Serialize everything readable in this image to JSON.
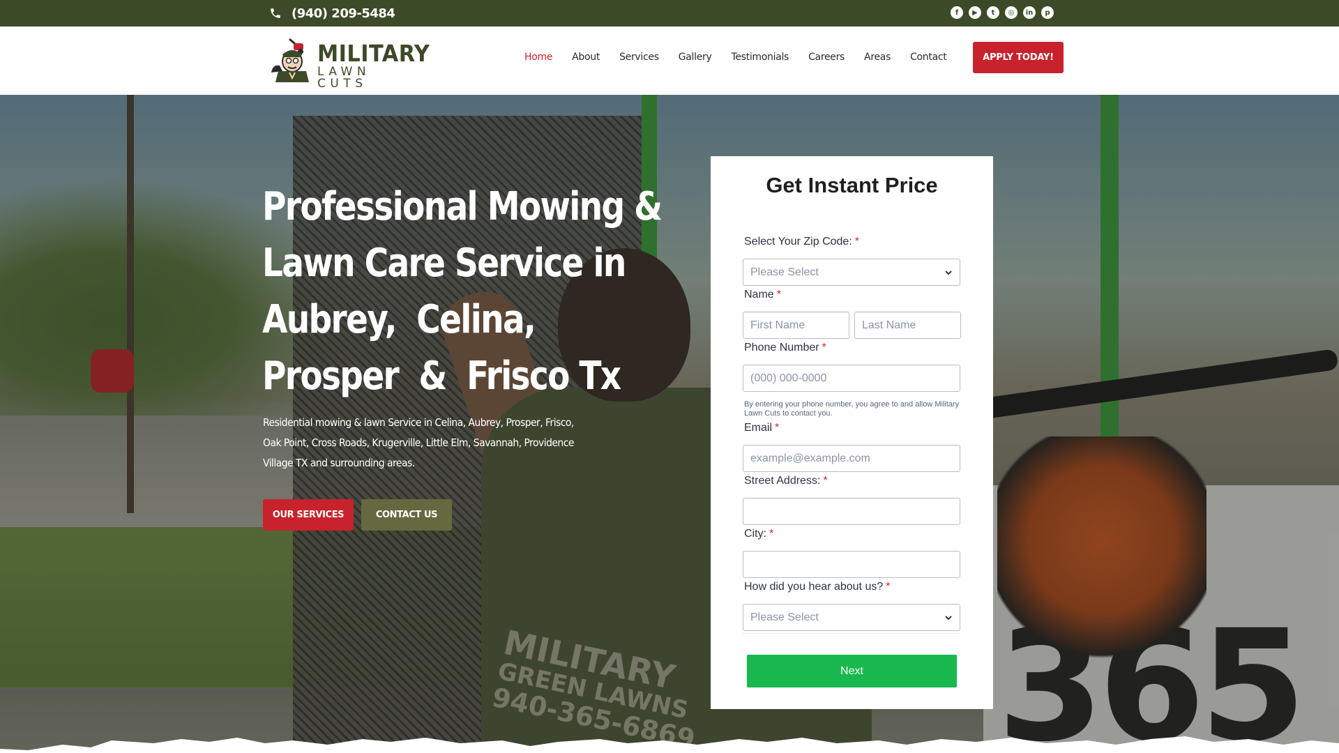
{
  "topbar": {
    "phone": "(940) 209-5484",
    "socials": [
      {
        "icon": "facebook-icon",
        "glyph": "f"
      },
      {
        "icon": "youtube-icon",
        "glyph": "▶"
      },
      {
        "icon": "twitter-icon",
        "glyph": "t"
      },
      {
        "icon": "instagram-icon",
        "glyph": "◎"
      },
      {
        "icon": "linkedin-icon",
        "glyph": "in"
      },
      {
        "icon": "pinterest-icon",
        "glyph": "p"
      }
    ]
  },
  "header": {
    "logo_line1": "MILITARY",
    "logo_line2": "LAWN CUTS",
    "nav": [
      "Home",
      "About",
      "Services",
      "Gallery",
      "Testimonials",
      "Careers",
      "Areas",
      "Contact"
    ],
    "active_nav": "Home",
    "apply_label": "APPLY TODAY!"
  },
  "hero": {
    "title_lines": [
      "Professional Mowing &",
      "Lawn Care Service in",
      "Aubrey,  Celina,",
      "Prosper  &  Frisco Tx"
    ],
    "subtitle": "Residential mowing & lawn Service in Celina, Aubrey, Prosper, Frisco, Oak Point, Cross Roads, Krugerville, Little Elm, Savannah, Providence Village TX and surrounding areas.",
    "services_label": "OUR SERVICES",
    "contact_label": "CONTACT US",
    "shirt_text": [
      "MILITARY",
      "GREEN LAWNS",
      "940-365-6869"
    ],
    "trailer_number": "365"
  },
  "form": {
    "title": "Get Instant Price",
    "zip_label": "Select Your Zip Code:",
    "zip_value": "Please Select",
    "name_label": "Name",
    "first_placeholder": "First Name",
    "last_placeholder": "Last Name",
    "phone_label": "Phone Number",
    "phone_placeholder": "(000) 000-0000",
    "phone_note": "By entering your phone number, you agree to and allow Military Lawn Cuts to contact you.",
    "email_label": "Email",
    "email_placeholder": "example@example.com",
    "street_label": "Street Address:",
    "city_label": "City:",
    "hear_label": "How did you hear about us?",
    "hear_value": "Please Select",
    "required_mark": "*",
    "next_label": "Next"
  },
  "colors": {
    "topbar": "#3d4a28",
    "brand_red": "#c8222c",
    "olive_button": "#66693f",
    "next_green": "#18b84f"
  }
}
